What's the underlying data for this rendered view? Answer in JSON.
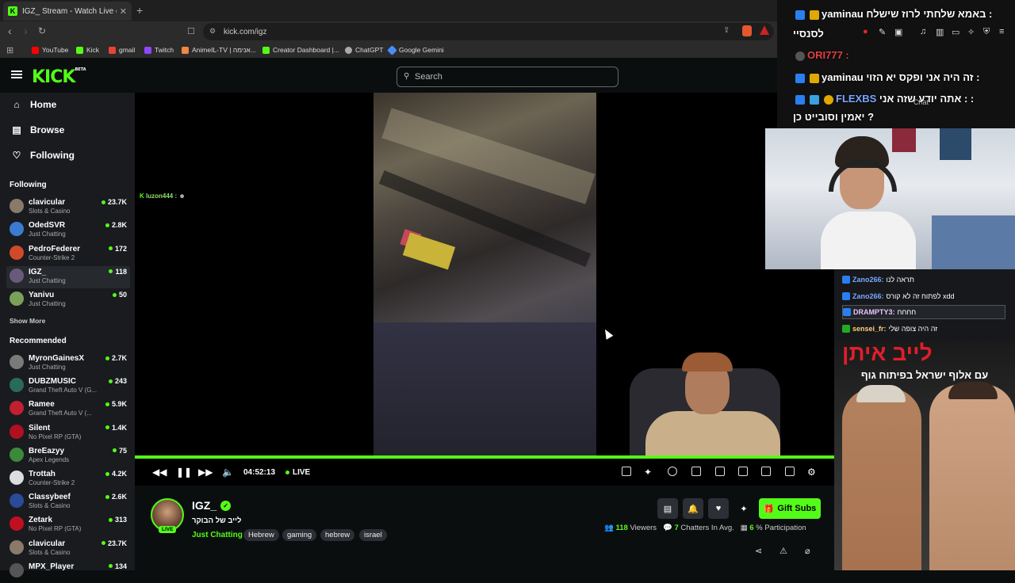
{
  "browser": {
    "tab_title": "IGZ_ Stream - Watch Live on Kick",
    "new_tab_label": "+",
    "url": "kick.com/igz",
    "bookmarks": [
      "YouTube",
      "Kick",
      "gmail",
      "Twitch",
      "AnimeIL-TV | אנימה...",
      "Creator Dashboard |...",
      "ChatGPT",
      "Google Gemini"
    ]
  },
  "kick": {
    "logo": "KICK",
    "logo_badge": "BETA",
    "search_placeholder": "Search",
    "nav": [
      {
        "label": "Home",
        "icon": "home-icon"
      },
      {
        "label": "Browse",
        "icon": "browse-icon"
      },
      {
        "label": "Following",
        "icon": "heart-icon"
      }
    ],
    "following_heading": "Following",
    "following": [
      {
        "name": "clavicular",
        "category": "Slots & Casino",
        "viewers": "23.7K",
        "color": "#8a7a6a"
      },
      {
        "name": "OdedSVR",
        "category": "Just Chatting",
        "viewers": "2.8K",
        "color": "#3b7bd0"
      },
      {
        "name": "PedroFederer",
        "category": "Counter-Strike 2",
        "viewers": "172",
        "color": "#d04a2a"
      },
      {
        "name": "IGZ_",
        "category": "Just Chatting",
        "viewers": "118",
        "color": "#6a5a7a"
      },
      {
        "name": "Yanivu",
        "category": "Just Chatting",
        "viewers": "50",
        "color": "#7aa05a"
      }
    ],
    "show_more": "Show More",
    "recommended_heading": "Recommended",
    "recommended": [
      {
        "name": "MyronGainesX",
        "category": "Just Chatting",
        "viewers": "2.7K",
        "color": "#7a7a7a"
      },
      {
        "name": "DUBZMUSIC",
        "category": "Grand Theft Auto V (G...",
        "viewers": "243",
        "color": "#2a6a5a"
      },
      {
        "name": "Ramee",
        "category": "Grand Theft Auto V (...",
        "viewers": "5.9K",
        "color": "#c02030"
      },
      {
        "name": "Silent",
        "category": "No Pixel RP (GTA)",
        "viewers": "1.4K",
        "color": "#b01020"
      },
      {
        "name": "BreEazyy",
        "category": "Apex Legends",
        "viewers": "75",
        "color": "#3a8a3a"
      },
      {
        "name": "Trottah",
        "category": "Counter-Strike 2",
        "viewers": "4.2K",
        "color": "#ddd"
      },
      {
        "name": "Classybeef",
        "category": "Slots & Casino",
        "viewers": "2.6K",
        "color": "#2a4a9a"
      },
      {
        "name": "Zetark",
        "category": "No Pixel RP (GTA)",
        "viewers": "313",
        "color": "#c01020"
      },
      {
        "name": "clavicular",
        "category": "Slots & Casino",
        "viewers": "23.7K",
        "color": "#8a7a6a"
      },
      {
        "name": "MPX_Player",
        "category": "",
        "viewers": "134",
        "color": "#555"
      }
    ]
  },
  "player": {
    "overlay_chat_user": "luzon444 :",
    "time": "04:52:13",
    "live_label": "LIVE",
    "progress_fraction": 1.0
  },
  "stream": {
    "channel": "IGZ_",
    "live_pill": "LIVE",
    "title": "לייב של הבוקר",
    "category": "Just Chatting",
    "tags": [
      "Hebrew",
      "gaming",
      "hebrew",
      "israel"
    ],
    "gift_label": "Gift Subs",
    "viewers": "118",
    "viewers_label": "Viewers",
    "chatters": "7",
    "chatters_label": "Chatters In Avg.",
    "participation": "6",
    "participation_label": "% Participation"
  },
  "overlay": {
    "chat": [
      {
        "user": "yaminau",
        "text": "באמא שלחתי לרוז שישלח :"
      },
      {
        "user": "",
        "text": "לסנסיי"
      },
      {
        "user": "ORI777 :",
        "text": ""
      },
      {
        "user": "yaminau",
        "text": "זה היה אני ופקס יא הזוי :"
      },
      {
        "user": "FLEXBS",
        "text": "אתה יודע שזה אני : :"
      },
      {
        "user": "",
        "text": "יאמין וסובייט כן ?"
      }
    ],
    "chat_header": "Chat",
    "side_chat": [
      {
        "user": "Zano266:",
        "text": "תראה לנו",
        "color": "#7aa6ff"
      },
      {
        "user": "Zano266:",
        "text": "לפתוח זה לא קורס xdd",
        "color": "#7aa6ff"
      },
      {
        "user": "DRAMPTY3:",
        "text": "חחחח",
        "color": "#e8c4ff"
      },
      {
        "user": "sensei_fr:",
        "text": "זה היה צופה שלי",
        "color": "#ffcf7a"
      }
    ],
    "ad_headline": "לייב איתן",
    "ad_sub": "עם אלוף ישראל בפיתוח גוף"
  }
}
